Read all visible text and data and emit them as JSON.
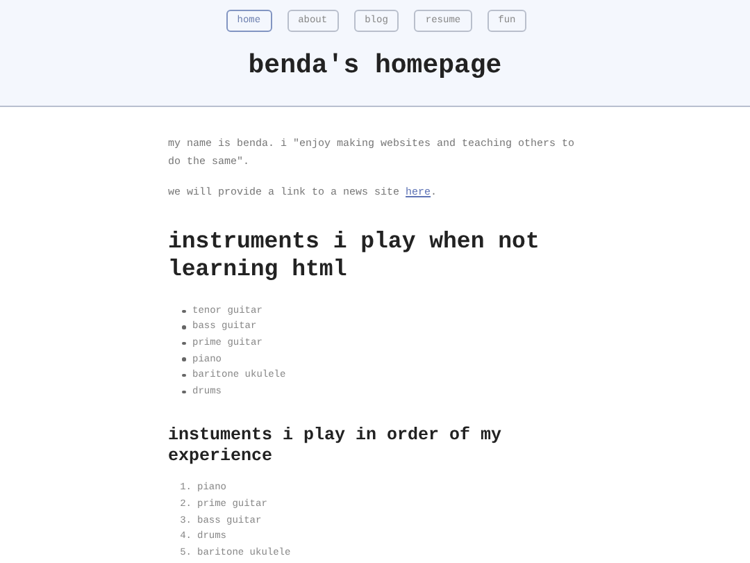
{
  "nav": [
    {
      "label": "home",
      "selected": true
    },
    {
      "label": "about",
      "selected": false
    },
    {
      "label": "blog",
      "selected": false
    },
    {
      "label": "resume",
      "selected": false
    },
    {
      "label": "fun",
      "selected": false
    }
  ],
  "site_title": "benda's homepage",
  "intro": "my name is benda. i \"enjoy making websites and teaching others to do the same\".",
  "link_paragraph": {
    "before": "we will provide a link to a news site ",
    "link": "here",
    "after": "."
  },
  "section_1": {
    "heading": "instruments i play when not learning html",
    "items": [
      "tenor guitar",
      "bass guitar",
      "prime guitar",
      "piano",
      "baritone ukulele",
      "drums"
    ]
  },
  "section_2": {
    "heading": "instuments i play in order of my experience",
    "items": [
      {
        "number": "1.",
        "text": "piano"
      },
      {
        "number": "2.",
        "text": "prime guitar"
      },
      {
        "number": "3.",
        "text": "bass guitar"
      },
      {
        "number": "4.",
        "text": "drums"
      },
      {
        "number": "5.",
        "text": "baritone ukulele"
      }
    ]
  }
}
